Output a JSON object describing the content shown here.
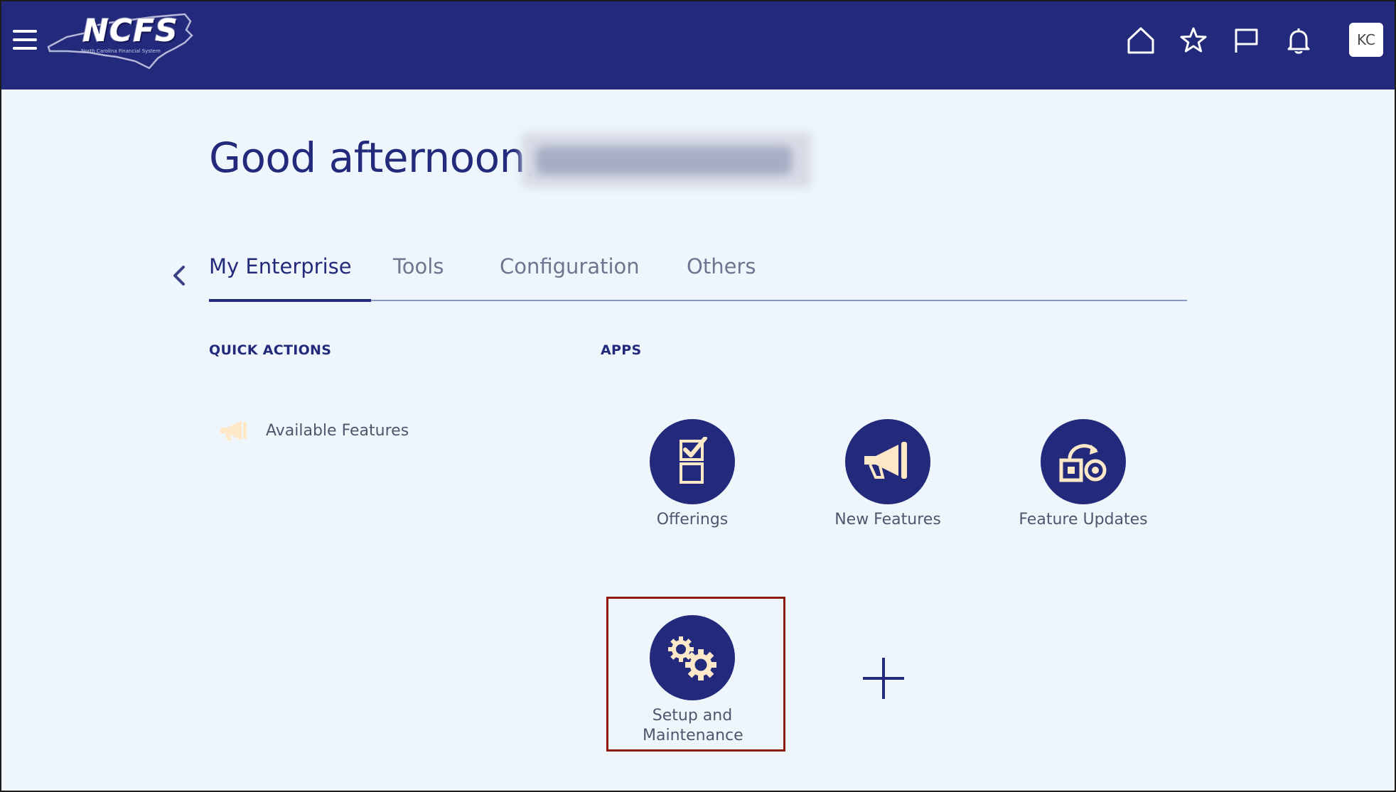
{
  "header": {
    "logo_text": "NCFS",
    "logo_subtitle": "North Carolina Financial System",
    "avatar_initials": "KC",
    "icons": [
      "menu-icon",
      "home-icon",
      "star-icon",
      "flag-icon",
      "bell-icon"
    ]
  },
  "greeting": {
    "text": "Good afternoon,"
  },
  "tabs": [
    {
      "label": "My Enterprise",
      "active": true
    },
    {
      "label": "Tools",
      "active": false
    },
    {
      "label": "Configuration",
      "active": false
    },
    {
      "label": "Others",
      "active": false
    }
  ],
  "quick_actions": {
    "heading": "QUICK ACTIONS",
    "items": [
      {
        "label": "Available Features",
        "icon": "megaphone-icon"
      }
    ]
  },
  "apps": {
    "heading": "APPS",
    "items": [
      {
        "label": "Offerings",
        "icon": "offerings-icon"
      },
      {
        "label": "New Features",
        "icon": "megaphone-icon"
      },
      {
        "label": "Feature Updates",
        "icon": "feature-updates-icon"
      },
      {
        "label": "Setup and Maintenance",
        "icon": "gears-icon",
        "highlighted": true
      }
    ]
  },
  "colors": {
    "brand_navy": "#232a7b",
    "page_bg": "#eef6fc",
    "icon_cream": "#fde9c8",
    "highlight_border": "#8b1c0c"
  }
}
